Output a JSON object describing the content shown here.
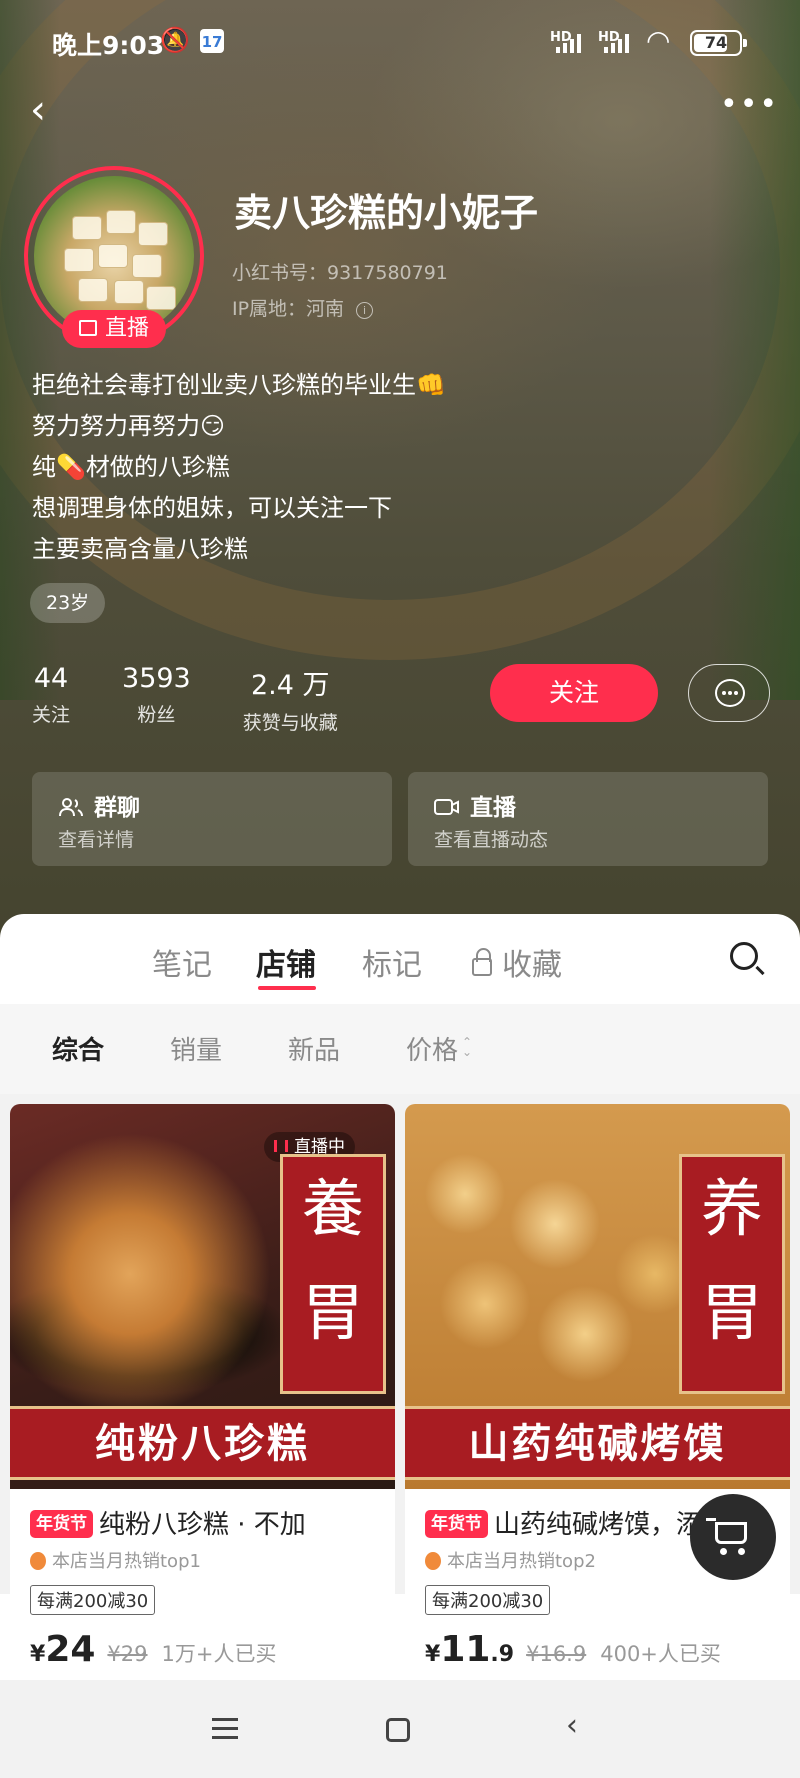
{
  "status_bar": {
    "time": "晚上9:03",
    "calendar_day": "17",
    "hd1": "HD",
    "hd2": "HD",
    "battery": "74"
  },
  "header": {
    "back_icon": "chevron-left-icon",
    "more_icon": "more-dots-icon"
  },
  "profile": {
    "live_badge": "直播",
    "nickname": "卖八珍糕的小妮子",
    "red_id": "小红书号：9317580791",
    "ip_location": "IP属地：河南",
    "bio": [
      "拒绝社会毒打创业卖八珍糕的毕业生👊",
      "努力努力再努力😏",
      "纯💊材做的八珍糕",
      "想调理身体的姐妹，可以关注一下",
      "主要卖高含量八珍糕"
    ],
    "age_tag": "23岁"
  },
  "stats": [
    {
      "num": "44",
      "label": "关注"
    },
    {
      "num": "3593",
      "label": "粉丝"
    },
    {
      "num": "2.4 万",
      "label": "获赞与收藏"
    }
  ],
  "actions": {
    "follow": "关注"
  },
  "cards": [
    {
      "title": "群聊",
      "sub": "查看详情",
      "icon": "group-icon"
    },
    {
      "title": "直播",
      "sub": "查看直播动态",
      "icon": "video-camera-icon"
    }
  ],
  "tabs": [
    {
      "label": "笔记",
      "active": false
    },
    {
      "label": "店铺",
      "active": true
    },
    {
      "label": "标记",
      "active": false
    },
    {
      "label": "收藏",
      "active": false
    }
  ],
  "filters": [
    {
      "label": "综合",
      "active": true
    },
    {
      "label": "销量",
      "active": false
    },
    {
      "label": "新品",
      "active": false
    },
    {
      "label": "价格",
      "active": false
    }
  ],
  "products": [
    {
      "live_chip": "直播中",
      "vertical_text": "養胃",
      "banner_text": "纯粉八珍糕",
      "tag": "年货节",
      "name": "纯粉八珍糕 · 不加",
      "rank": "本店当月热销top1",
      "promo": "每满200减30",
      "currency": "¥",
      "price_int": "24",
      "price_dec": "",
      "price_old": "¥29",
      "sold": "1万+人已买"
    },
    {
      "live_chip": "",
      "vertical_text": "养胃",
      "banner_text": "山药纯碱烤馍",
      "tag": "年货节",
      "name": "山药纯碱烤馍，添加",
      "rank": "本店当月热销top2",
      "promo": "每满200减30",
      "currency": "¥",
      "price_int": "11",
      "price_dec": ".9",
      "price_old": "¥16.9",
      "sold": "400+人已买"
    }
  ],
  "colors": {
    "accent": "#ff2e4d",
    "banner_red": "#a81c22"
  }
}
